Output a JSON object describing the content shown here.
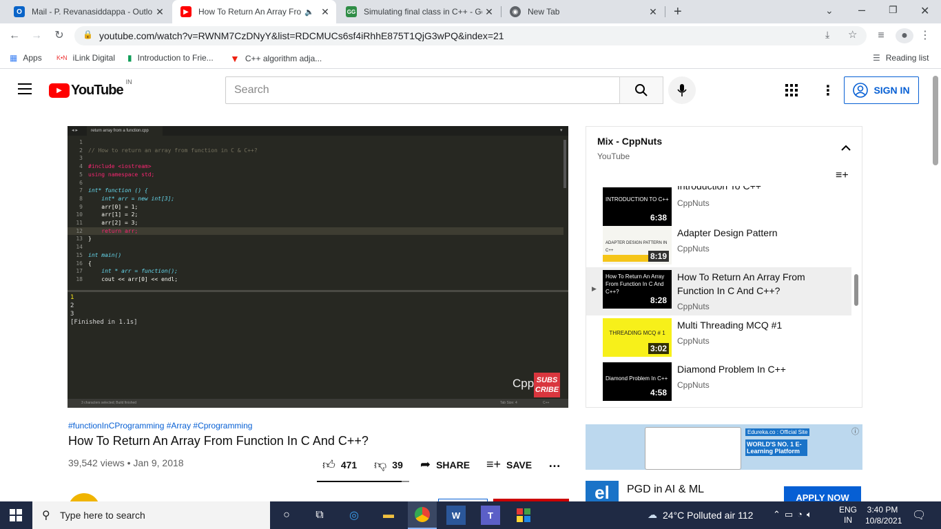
{
  "browser": {
    "tabs": [
      {
        "title": "Mail - P. Revanasiddappa - Outlo",
        "icon": "outlook-icon"
      },
      {
        "title": "How To Return An Array Fro",
        "icon": "youtube-icon"
      },
      {
        "title": "Simulating final class in C++ - Ge",
        "icon": "geeksforgeeks-icon"
      },
      {
        "title": "New Tab",
        "icon": "chrome-icon"
      }
    ],
    "url": "youtube.com/watch?v=RWNM7CzDNyY&list=RDCMUCs6sf4iRhhE875T1QjG3wPQ&index=21",
    "bookmarks": [
      "Apps",
      "iLink Digital",
      "Introduction to Frie...",
      "C++ algorithm adja..."
    ],
    "reading_list": "Reading list"
  },
  "youtube": {
    "logo": "YouTube",
    "region": "IN",
    "search_placeholder": "Search",
    "sign_in": "SIGN IN"
  },
  "video": {
    "tab_file": "return array from a function.cpp",
    "code_lines": [
      {
        "n": "1",
        "t": ""
      },
      {
        "n": "2",
        "t": "// How to return an array from function in C & C++?"
      },
      {
        "n": "3",
        "t": ""
      },
      {
        "n": "4",
        "t": "#include <iostream>"
      },
      {
        "n": "5",
        "t": "using namespace std;"
      },
      {
        "n": "6",
        "t": ""
      },
      {
        "n": "7",
        "t": "int* function () {"
      },
      {
        "n": "8",
        "t": "    int* arr = new int[3];"
      },
      {
        "n": "9",
        "t": "    arr[0] = 1;"
      },
      {
        "n": "10",
        "t": "    arr[1] = 2;"
      },
      {
        "n": "11",
        "t": "    arr[2] = 3;"
      },
      {
        "n": "12",
        "t": "    return arr;"
      },
      {
        "n": "13",
        "t": "}"
      },
      {
        "n": "14",
        "t": ""
      },
      {
        "n": "15",
        "t": "int main()"
      },
      {
        "n": "16",
        "t": "{"
      },
      {
        "n": "17",
        "t": "    int * arr = function();"
      },
      {
        "n": "18",
        "t": "    cout << arr[0] << endl;"
      }
    ],
    "output": [
      "1",
      "2",
      "3",
      "[Finished in 1.1s]"
    ],
    "status_left": "3 characters selected; Build finished",
    "status_right": "Tab Size: 4",
    "status_lang": "C++",
    "watermark": "Cpp",
    "subscribe": "SUBS CRIBE",
    "hashtags": "#functionInCProgramming #Array #Cprogramming",
    "title": "How To Return An Array From Function In C And C++?",
    "views": "39,542 views • Jan 9, 2018",
    "likes": "471",
    "dislikes": "39",
    "share": "SHARE",
    "save": "SAVE"
  },
  "playlist": {
    "title": "Mix - CppNuts",
    "subtitle": "YouTube",
    "items": [
      {
        "title": "Introduction To C++",
        "channel": "CppNuts",
        "duration": "6:38",
        "thumb_text": "INTRODUCTION TO C++"
      },
      {
        "title": "Adapter Design Pattern",
        "channel": "CppNuts",
        "duration": "8:19",
        "thumb_text": "ADAPTER DESIGN PATTERN IN C++"
      },
      {
        "title": "How To Return An Array From Function In C And C++?",
        "channel": "CppNuts",
        "duration": "8:28",
        "thumb_text": "How To Return An Array From Function In C And C++?"
      },
      {
        "title": "Multi Threading MCQ #1",
        "channel": "CppNuts",
        "duration": "3:02",
        "thumb_text": "THREADING MCQ # 1"
      },
      {
        "title": "Diamond Problem In C++",
        "channel": "CppNuts",
        "duration": "4:58",
        "thumb_text": "Diamond Problem In C++"
      }
    ]
  },
  "ad": {
    "brand": "Edureka.co : Official Site",
    "headline": "WORLD'S NO. 1 E-Learning Platform",
    "course": "PGD in AI & ML",
    "cta": "APPLY NOW"
  },
  "taskbar": {
    "search": "Type here to search",
    "weather": "24°C  Polluted air 112",
    "lang_top": "ENG",
    "lang_bottom": "IN",
    "time": "3:40 PM",
    "date": "10/8/2021"
  }
}
